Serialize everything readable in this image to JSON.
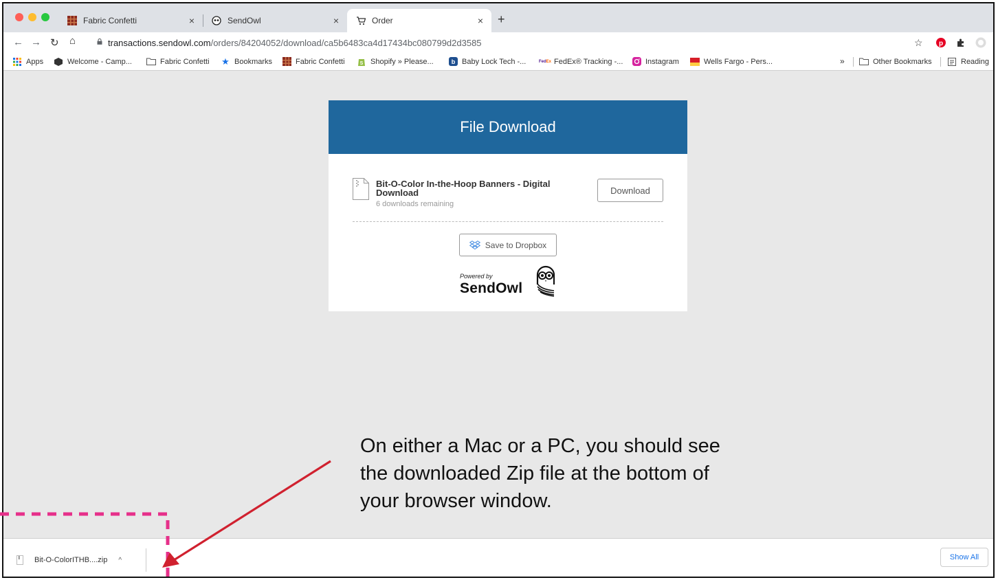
{
  "tabs": [
    {
      "title": "Fabric Confetti",
      "close": "×",
      "icon": "fabric-confetti-favicon"
    },
    {
      "title": "SendOwl",
      "close": "×",
      "icon": "sendowl-favicon"
    },
    {
      "title": "Order",
      "close": "×",
      "icon": "cart-icon",
      "active": true
    }
  ],
  "new_tab": "+",
  "address": {
    "domain": "transactions.sendowl.com",
    "path": "/orders/84204052/download/ca5b6483ca4d17434bc080799d2d3585"
  },
  "bookmarks": [
    {
      "label": "Apps",
      "icon": "apps-grid-icon"
    },
    {
      "label": "Welcome - Camp...",
      "icon": "cube-icon"
    },
    {
      "label": "Fabric Confetti",
      "icon": "folder-icon"
    },
    {
      "label": "Bookmarks",
      "icon": "star-icon"
    },
    {
      "label": "Fabric Confetti",
      "icon": "fabric-confetti-favicon"
    },
    {
      "label": "Shopify » Please...",
      "icon": "shopify-icon"
    },
    {
      "label": "Baby Lock Tech -...",
      "icon": "babylock-icon"
    },
    {
      "label": "FedEx® Tracking -...",
      "icon": "fedex-icon"
    },
    {
      "label": "Instagram",
      "icon": "instagram-icon"
    },
    {
      "label": "Wells Fargo - Pers...",
      "icon": "wellsfargo-icon"
    }
  ],
  "bookmarks_overflow": "»",
  "other_bookmarks": "Other Bookmarks",
  "reading_list": "Reading",
  "card": {
    "header": "File Download",
    "file_title": "Bit-O-Color In-the-Hoop Banners - Digital Download",
    "file_sub": "6 downloads remaining",
    "download_label": "Download",
    "dropbox_label": "Save to Dropbox",
    "powered_by": "Powered by",
    "brand": "SendOwl"
  },
  "caption": "On either a Mac or a PC, you should see the downloaded Zip file at the bottom of your browser window.",
  "shelf": {
    "file_name": "Bit-O-ColorITHB....zip",
    "chevron": "^",
    "show_all": "Show All"
  },
  "colors": {
    "header_blue": "#1f679d",
    "annotation_pink": "#e6308a",
    "arrow_red": "#d0212f",
    "link_blue": "#1a73e8"
  }
}
